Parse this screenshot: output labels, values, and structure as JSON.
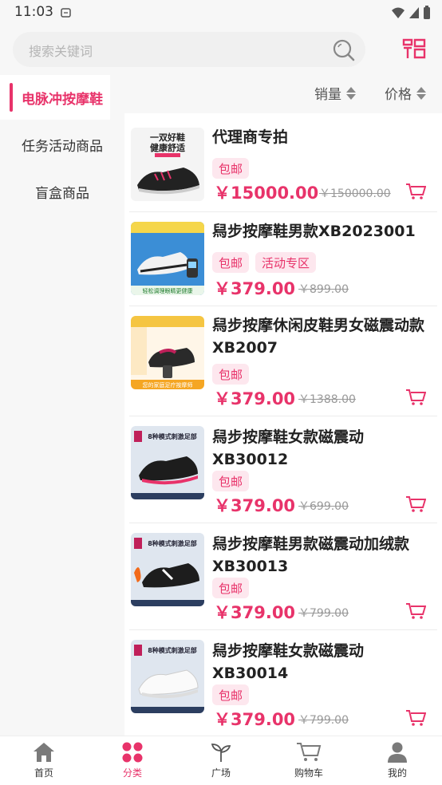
{
  "status": {
    "time": "11:03"
  },
  "search": {
    "placeholder": "搜索关键词"
  },
  "sidebar": {
    "items": [
      {
        "label": "电脉冲按摩鞋",
        "active": true
      },
      {
        "label": "任务活动商品",
        "active": false
      },
      {
        "label": "盲盒商品",
        "active": false
      }
    ]
  },
  "sort": {
    "sales_label": "销量",
    "price_label": "价格"
  },
  "products": [
    {
      "title": "代理商专拍",
      "tags": [
        "包邮"
      ],
      "price": "￥15000.00",
      "original_price": "￥150000.00",
      "thumb_text": "一双好鞋 健康舒适"
    },
    {
      "title": "舄步按摩鞋男款XB2023001",
      "tags": [
        "包邮",
        "活动专区"
      ],
      "price": "￥379.00",
      "original_price": "￥899.00",
      "thumb_text": "轻松调理眼睛更健康"
    },
    {
      "title": "舄步按摩休闲皮鞋男女磁震动款XB2007",
      "tags": [
        "包邮"
      ],
      "price": "￥379.00",
      "original_price": "￥1388.00",
      "thumb_text": "您的家庭足疗按摩师"
    },
    {
      "title": "舄步按摩鞋女款磁震动XB30012",
      "tags": [
        "包邮"
      ],
      "price": "￥379.00",
      "original_price": "￥699.00",
      "thumb_text": "8种模式刺激足部"
    },
    {
      "title": "舄步按摩鞋男款磁震动加绒款XB30013",
      "tags": [
        "包邮"
      ],
      "price": "￥379.00",
      "original_price": "￥799.00",
      "thumb_text": "8种模式刺激足部"
    },
    {
      "title": "舄步按摩鞋女款磁震动XB30014",
      "tags": [
        "包邮"
      ],
      "price": "￥379.00",
      "original_price": "￥799.00",
      "thumb_text": "8种模式刺激足部"
    }
  ],
  "tabs": [
    {
      "label": "首页",
      "icon": "home-icon"
    },
    {
      "label": "分类",
      "icon": "category-icon",
      "active": true
    },
    {
      "label": "广场",
      "icon": "sprout-icon"
    },
    {
      "label": "购物车",
      "icon": "cart-icon"
    },
    {
      "label": "我的",
      "icon": "user-icon"
    }
  ],
  "colors": {
    "accent": "#e8336a",
    "tag_bg": "#fde7ee",
    "sidebar_bg": "#f7f7f7"
  }
}
